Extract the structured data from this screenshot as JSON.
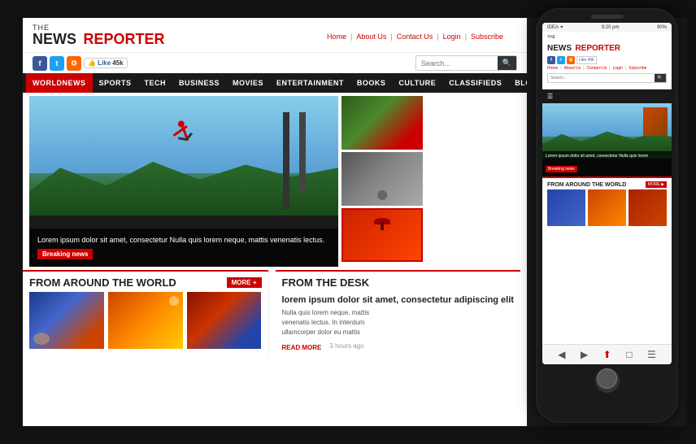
{
  "background": "#1a1a1a",
  "website": {
    "logo": {
      "the": "THE",
      "news": "NEWS",
      "reporter": "REPORTER"
    },
    "top_nav": {
      "items": [
        {
          "label": "Home"
        },
        {
          "label": "About Us"
        },
        {
          "label": "Contact Us"
        },
        {
          "label": "Login"
        },
        {
          "label": "Subscribe"
        }
      ]
    },
    "search_placeholder": "Search...",
    "search_btn": "🔍",
    "nav_items": [
      {
        "label": "WORLDNEWS",
        "active": true
      },
      {
        "label": "SPORTS"
      },
      {
        "label": "TECH"
      },
      {
        "label": "BUSINESS"
      },
      {
        "label": "MOVIES"
      },
      {
        "label": "ENTERTAINMENT"
      },
      {
        "label": "BOOKS"
      },
      {
        "label": "CULTURE"
      },
      {
        "label": "CLASSIFIEDS"
      },
      {
        "label": "BLOGS"
      }
    ],
    "hero": {
      "caption": "Lorem ipsum dolor sit amet, consectetur Nulla quis lorem neque, mattis venenatis lectus.",
      "breaking_label": "Breaking news"
    },
    "sections": {
      "from_world": {
        "title": "FROM AROUND THE WORLD",
        "more_label": "MORE +"
      },
      "from_desk": {
        "title": "FROM THE DESK",
        "article_title": "lorem ipsum dolor sit amet, consectetur adipiscing elit",
        "body_line1": "Nulla quis lorem neque, mattis",
        "body_line2": "venenatis lectus. In interdum",
        "body_line3": "ullamcorper dolor eu mattis",
        "read_more": "READ MORE",
        "time_ago": "3 hours ago"
      }
    },
    "social": {
      "fb_label": "f",
      "tw_label": "t",
      "rss_label": "r",
      "like_label": "Like",
      "like_count": "45k"
    }
  },
  "phone": {
    "status": {
      "carrier": "IDEA ✦",
      "time": "9:20 pm",
      "battery": "90%"
    },
    "logo": {
      "the": "THE",
      "news": "NEWS",
      "reporter": "REPORTER"
    },
    "top_nav_labels": [
      "Home",
      "|",
      "About Us",
      "|",
      "Contact Us",
      "|",
      "Login",
      "|",
      "Subscribe"
    ],
    "hero_text": "Lorem ipsum dolor sit amet, consectetur Nulla quis lorem",
    "breaking_label": "Breaking news",
    "section_title": "FROM AROUND THE WORLD",
    "more_label": "MORE ▶",
    "bottom_icons": [
      "◀",
      "▶",
      "⬆",
      "□",
      "☰"
    ]
  }
}
